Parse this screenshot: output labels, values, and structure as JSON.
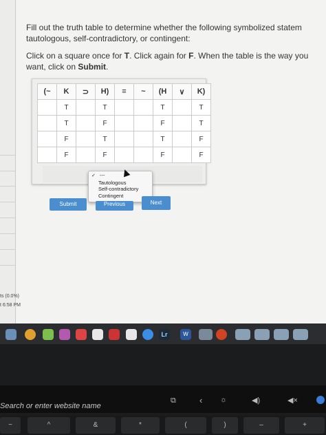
{
  "instructions": {
    "line1": "Fill out the truth table to determine whether the following symbolized statem",
    "line2": "tautologous, self-contradictory, or contingent:",
    "click_a": "Click on a square once for ",
    "t": "T",
    "click_b": ". Click again for ",
    "f": "F",
    "click_c": ". When the table is the way you",
    "line4a": "want, click on ",
    "submit_word": "Submit",
    "line4b": "."
  },
  "headers": [
    "(~",
    "K",
    "⊃",
    "H)",
    "≡",
    "~",
    "(H",
    "∨",
    "K)"
  ],
  "rows": [
    [
      "",
      "T",
      "",
      "T",
      "",
      "",
      "T",
      "",
      "T"
    ],
    [
      "",
      "T",
      "",
      "F",
      "",
      "",
      "F",
      "",
      "T"
    ],
    [
      "",
      "F",
      "",
      "T",
      "",
      "",
      "T",
      "",
      "F"
    ],
    [
      "",
      "F",
      "",
      "F",
      "",
      "",
      "F",
      "",
      "F"
    ]
  ],
  "dropdown": {
    "selected": "---",
    "options": [
      "Tautologous",
      "Self-contradictory",
      "Contingent"
    ]
  },
  "buttons": {
    "submit": "Submit",
    "previous": "Previous",
    "next": "Next"
  },
  "sidebar": {
    "pts": "ts (0.0%)",
    "time": "t 6:58 PM"
  },
  "dock": {
    "lr": "Lr",
    "w": "W"
  },
  "touchbar": {
    "search": "Search or enter website name"
  }
}
